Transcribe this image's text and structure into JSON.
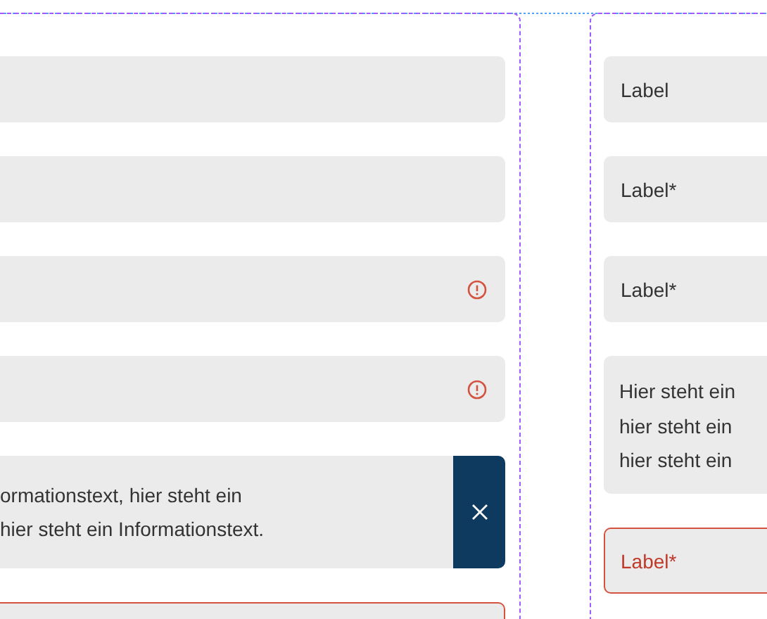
{
  "left_column": {
    "items": [
      {
        "kind": "field",
        "error": false,
        "warning_icon": false
      },
      {
        "kind": "field",
        "error": false,
        "warning_icon": false
      },
      {
        "kind": "field",
        "error": false,
        "warning_icon": true
      },
      {
        "kind": "field",
        "error": false,
        "warning_icon": true
      },
      {
        "kind": "info",
        "lines": [
          "ormationstext, hier steht ein",
          "hier steht ein Informationstext."
        ]
      },
      {
        "kind": "field",
        "error": true,
        "warning_icon": false
      }
    ]
  },
  "right_column": {
    "items": [
      {
        "kind": "field",
        "label": "Label",
        "error": false
      },
      {
        "kind": "field",
        "label": "Label*",
        "error": false
      },
      {
        "kind": "field",
        "label": "Label*",
        "error": false
      },
      {
        "kind": "text",
        "lines": [
          "Hier steht ein",
          "hier steht ein",
          "hier steht ein"
        ]
      },
      {
        "kind": "field",
        "label": "Label*",
        "error": true
      }
    ]
  }
}
